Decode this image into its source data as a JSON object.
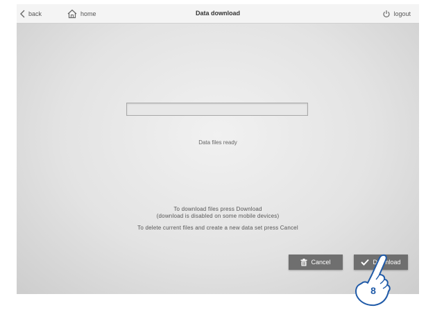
{
  "topbar": {
    "back_label": "back",
    "home_label": "home",
    "title": "Data download",
    "logout_label": "logout"
  },
  "progress": {
    "fraction": 0.0
  },
  "status_text": "Data files ready",
  "instructions": {
    "line1": "To download files press Download",
    "line2": "(download is disabled on some mobile devices)",
    "line3": "To delete current files and create a new data set press Cancel"
  },
  "buttons": {
    "cancel_label": "Cancel",
    "download_label": "Download"
  },
  "annotation": {
    "step_number": "8"
  },
  "icons": {
    "back": "chevron-left-icon",
    "home": "home-icon",
    "logout": "power-icon",
    "cancel": "trash-icon",
    "download": "checkmark-icon",
    "pointer": "pointing-hand-icon"
  },
  "colors": {
    "button_bg": "#6f6f6f",
    "annotation_blue": "#1f5aa8"
  }
}
